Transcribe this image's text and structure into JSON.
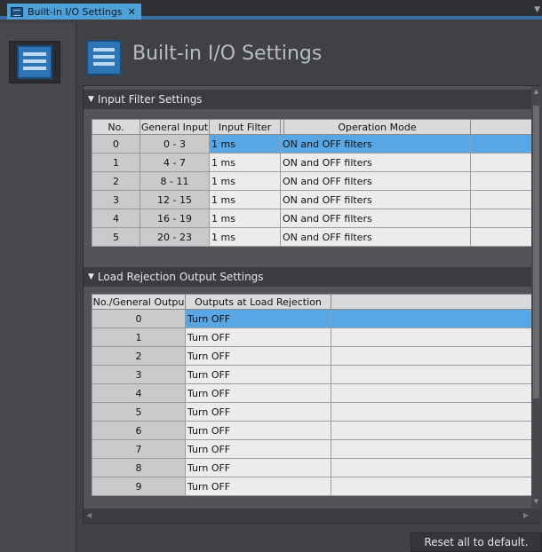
{
  "tab": {
    "label": "Built-in I/O Settings",
    "close": "✕"
  },
  "header": {
    "title": "Built-in I/O Settings"
  },
  "input_filter": {
    "title": "Input Filter Settings",
    "columns": [
      "No.",
      "General Input",
      "Input Filter",
      "",
      "Operation Mode",
      ""
    ],
    "rows": [
      {
        "no": "0",
        "input": "0 - 3",
        "filter": "1 ms",
        "mode": "ON and OFF filters"
      },
      {
        "no": "1",
        "input": "4 - 7",
        "filter": "1 ms",
        "mode": "ON and OFF filters"
      },
      {
        "no": "2",
        "input": "8 - 11",
        "filter": "1 ms",
        "mode": "ON and OFF filters"
      },
      {
        "no": "3",
        "input": "12 - 15",
        "filter": "1 ms",
        "mode": "ON and OFF filters"
      },
      {
        "no": "4",
        "input": "16 - 19",
        "filter": "1 ms",
        "mode": "ON and OFF filters"
      },
      {
        "no": "5",
        "input": "20 - 23",
        "filter": "1 ms",
        "mode": "ON and OFF filters"
      }
    ]
  },
  "load_rejection": {
    "title": "Load Rejection Output Settings",
    "columns": [
      "No./General Outpu",
      "Outputs at Load Rejection",
      ""
    ],
    "rows": [
      {
        "no": "0",
        "output": "Turn OFF"
      },
      {
        "no": "1",
        "output": "Turn OFF"
      },
      {
        "no": "2",
        "output": "Turn OFF"
      },
      {
        "no": "3",
        "output": "Turn OFF"
      },
      {
        "no": "4",
        "output": "Turn OFF"
      },
      {
        "no": "5",
        "output": "Turn OFF"
      },
      {
        "no": "6",
        "output": "Turn OFF"
      },
      {
        "no": "7",
        "output": "Turn OFF"
      },
      {
        "no": "8",
        "output": "Turn OFF"
      },
      {
        "no": "9",
        "output": "Turn OFF"
      }
    ]
  },
  "footer": {
    "reset_label": "Reset all to default."
  }
}
